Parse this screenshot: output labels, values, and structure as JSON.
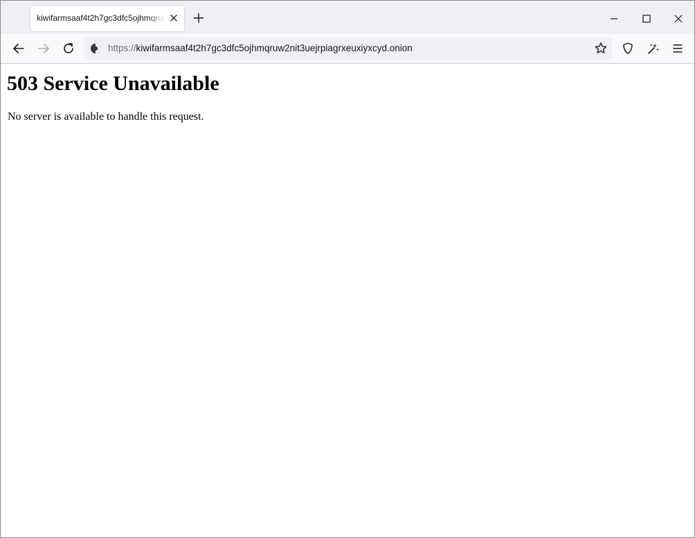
{
  "browser": {
    "tab": {
      "title": "kiwifarmsaaf4t2h7gc3dfc5ojhmqruw2nit3uejrpiagrxeuxiyxcyd.onion"
    },
    "url": {
      "scheme": "https://",
      "host": "kiwifarmsaaf4t2h7gc3dfc5ojhmqruw2nit3uejrpiagrxeuxiyxcyd.onion"
    },
    "icons": {
      "tab_close": "close-icon",
      "new_tab": "plus-icon",
      "minimize": "minimize-icon",
      "maximize": "maximize-icon",
      "close_window": "close-icon",
      "back": "back-arrow-icon",
      "forward": "forward-arrow-icon",
      "reload": "reload-icon",
      "onion_site": "onion-icon",
      "bookmark": "star-icon",
      "tracking_protection": "shield-icon",
      "extensions": "magic-wand-icon",
      "menu": "hamburger-menu-icon"
    }
  },
  "page": {
    "heading": "503 Service Unavailable",
    "message": "No server is available to handle this request."
  }
}
